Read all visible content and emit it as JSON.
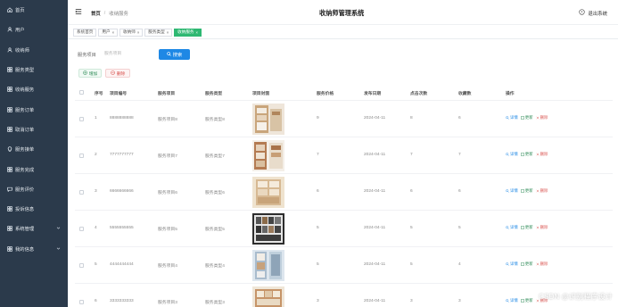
{
  "colors": {
    "sidebar_bg": "#2b3a4b",
    "accent": "#1e88e5",
    "active_tag": "#2eb872",
    "danger": "#d9534f",
    "success": "#2e8b57"
  },
  "sidebar": {
    "items": [
      {
        "label": "首页",
        "icon": "home-icon"
      },
      {
        "label": "用户",
        "icon": "user-icon"
      },
      {
        "label": "收纳师",
        "icon": "user-icon"
      },
      {
        "label": "服务类型",
        "icon": "grid-icon"
      },
      {
        "label": "收纳服务",
        "icon": "grid-icon"
      },
      {
        "label": "服务订单",
        "icon": "grid-icon"
      },
      {
        "label": "取消订单",
        "icon": "grid-icon"
      },
      {
        "label": "服务接单",
        "icon": "bulb-icon"
      },
      {
        "label": "服务完成",
        "icon": "grid-icon"
      },
      {
        "label": "服务评价",
        "icon": "chat-icon"
      },
      {
        "label": "投诉信息",
        "icon": "grid-icon"
      },
      {
        "label": "系统管理",
        "icon": "grid-icon",
        "expandable": true
      },
      {
        "label": "我的信息",
        "icon": "grid-icon",
        "expandable": true
      }
    ]
  },
  "header": {
    "breadcrumb_home": "首页",
    "breadcrumb_sep": "/",
    "breadcrumb_current": "收纳服务",
    "system_title": "收纳师管理系统",
    "logout_label": "退出系统"
  },
  "tags": [
    {
      "label": "系统首页",
      "closable": false,
      "active": false
    },
    {
      "label": "用户",
      "closable": true,
      "active": false
    },
    {
      "label": "收纳师",
      "closable": true,
      "active": false
    },
    {
      "label": "服务类型",
      "closable": true,
      "active": false
    },
    {
      "label": "收纳服务",
      "closable": true,
      "active": true
    }
  ],
  "search": {
    "label": "服务项目",
    "placeholder": "服务项目",
    "button_label": "搜索"
  },
  "actions": {
    "add_label": "增加",
    "delete_label": "删除"
  },
  "table": {
    "headers": {
      "index": "序号",
      "code": "项目编号",
      "item": "服务项目",
      "type": "服务类型",
      "image": "项目封面",
      "price": "服务价格",
      "date": "发布日期",
      "clicks": "点击次数",
      "favorites": "收藏数",
      "actions": "操作"
    },
    "rows": [
      {
        "index": "1",
        "code": "8888888888",
        "item": "服务项目8",
        "type": "服务类型8",
        "price": "9",
        "date": "2024-04-11",
        "clicks": "8",
        "favorites": "6"
      },
      {
        "index": "2",
        "code": "7777777777",
        "item": "服务项目7",
        "type": "服务类型7",
        "price": "7",
        "date": "2024-04-11",
        "clicks": "7",
        "favorites": "7"
      },
      {
        "index": "3",
        "code": "6666666666",
        "item": "服务项目6",
        "type": "服务类型6",
        "price": "6",
        "date": "2024-04-11",
        "clicks": "6",
        "favorites": "6"
      },
      {
        "index": "4",
        "code": "5555555555",
        "item": "服务项目5",
        "type": "服务类型5",
        "price": "5",
        "date": "2024-04-11",
        "clicks": "5",
        "favorites": "5"
      },
      {
        "index": "5",
        "code": "4444444444",
        "item": "服务项目4",
        "type": "服务类型4",
        "price": "5",
        "date": "2024-04-11",
        "clicks": "5",
        "favorites": "4"
      },
      {
        "index": "6",
        "code": "3333333333",
        "item": "服务项目3",
        "type": "服务类型3",
        "price": "3",
        "date": "2024-04-11",
        "clicks": "3",
        "favorites": "3"
      }
    ],
    "row_actions": {
      "view": "详情",
      "edit": "更新",
      "delete": "删除"
    }
  },
  "watermark": "CSDN @识别程序设计"
}
